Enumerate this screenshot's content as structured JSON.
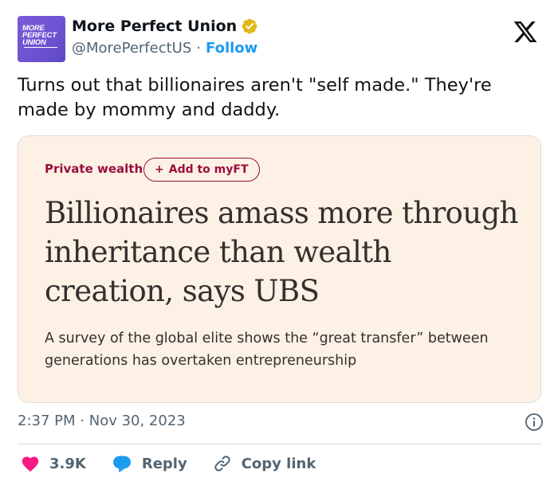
{
  "author": {
    "avatar_text": [
      "MORE",
      "PERFECT",
      "UNION"
    ],
    "name": "More Perfect Union",
    "handle": "@MorePerfectUS",
    "separator": "·",
    "follow_label": "Follow",
    "verified": true
  },
  "tweet": {
    "text": "Turns out that billionaires aren't \"self made.\" They're made by mommy and daddy."
  },
  "card": {
    "topic": "Private wealth",
    "pill_plus": "+",
    "pill_label": "Add to myFT",
    "headline": "Billionaires amass more through inheritance than wealth creation, says UBS",
    "subheading": "A survey of the global elite shows the “great transfer” between generations has overtaken entrepreneurship"
  },
  "meta": {
    "time": "2:37 PM",
    "separator": "·",
    "date": "Nov 30, 2023"
  },
  "actions": {
    "likes": "3.9K",
    "reply": "Reply",
    "copy_link": "Copy link"
  },
  "colors": {
    "accent": "#1d9bf0",
    "heart": "#f91880",
    "card_bg": "#fdf1e5",
    "ft_claret": "#990f3d",
    "avatar": "#6c52d1"
  },
  "icons": [
    "verified-badge-icon",
    "x-logo-icon",
    "info-icon",
    "heart-icon",
    "reply-bubble-icon",
    "link-icon",
    "plus-icon"
  ]
}
